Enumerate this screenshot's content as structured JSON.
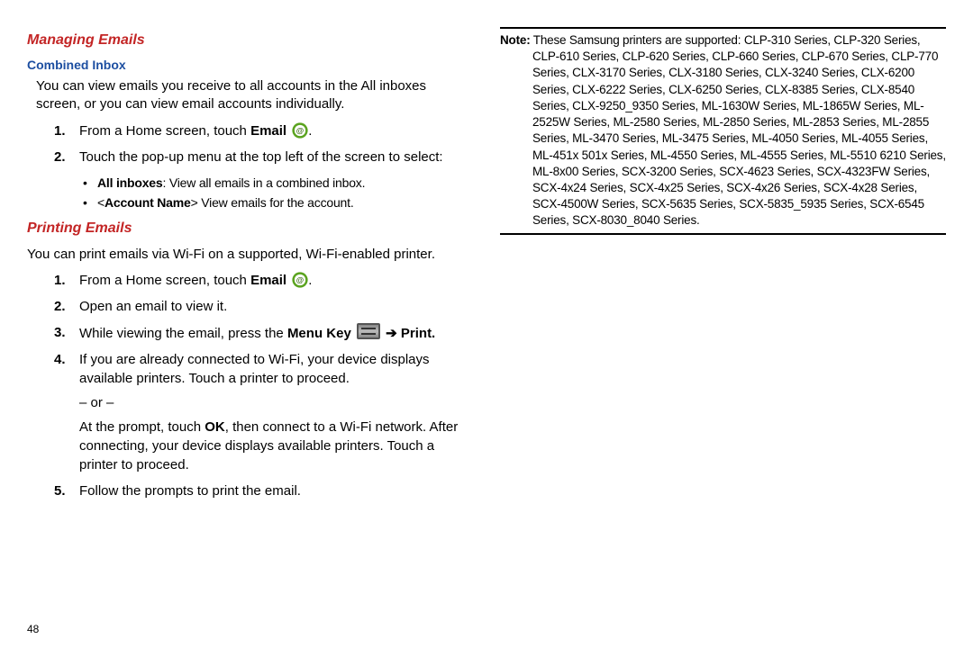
{
  "page_number": "48",
  "left": {
    "h1": "Managing Emails",
    "h2": "Combined Inbox",
    "combined_para": "You can view emails you receive to all accounts in the All inboxes screen, or you can view email accounts individually.",
    "steps_combined": {
      "s1_a": "From a Home screen, touch ",
      "s1_b": "Email",
      "s1_c": ".",
      "s2": "Touch the pop-up menu at the top left of the screen to select:"
    },
    "bullets": {
      "b1_a": "All inboxes",
      "b1_b": ": View all emails in a combined inbox.",
      "b2_a": "<",
      "b2_b": "Account Name",
      "b2_c": "> View emails for the account."
    },
    "h1b": "Printing Emails",
    "print_para": "You can print emails via Wi-Fi on a supported, Wi-Fi-enabled printer.",
    "steps_print": {
      "s1_a": "From a Home screen, touch ",
      "s1_b": "Email",
      "s1_c": ".",
      "s2": "Open an email to view it.",
      "s3_a": "While viewing the email, press the ",
      "s3_b": "Menu Key",
      "s3_c": " ",
      "s3_d": "Print.",
      "s4_a": "If you are already connected to Wi-Fi, your device displays available printers. Touch a printer to proceed.",
      "s4_or": "– or –",
      "s4_b_a": "At the prompt, touch ",
      "s4_b_b": "OK",
      "s4_b_c": ", then connect to a Wi-Fi network. After connecting, your device displays available printers. Touch a printer to proceed.",
      "s5": "Follow the prompts to print the email."
    },
    "arrow": "➔"
  },
  "right": {
    "note_label": "Note:",
    "note_text": " These Samsung printers are supported: CLP-310 Series, CLP-320 Series, CLP-610 Series, CLP-620 Series, CLP-660 Series, CLP-670 Series, CLP-770 Series, CLX-3170 Series, CLX-3180 Series, CLX-3240 Series, CLX-6200 Series, CLX-6222 Series, CLX-6250 Series, CLX-8385 Series, CLX-8540 Series, CLX-9250_9350 Series, ML-1630W Series, ML-1865W Series, ML-2525W Series, ML-2580 Series, ML-2850 Series, ML-2853 Series, ML-2855 Series, ML-3470 Series, ML-3475 Series, ML-4050 Series, ML-4055 Series, ML-451x 501x Series, ML-4550 Series, ML-4555 Series, ML-5510 6210 Series, ML-8x00 Series,  SCX-3200 Series, SCX-4623 Series, SCX-4323FW Series, SCX-4x24 Series, SCX-4x25 Series, SCX-4x26 Series, SCX-4x28 Series, SCX-4500W Series, SCX-5635 Series, SCX-5835_5935 Series, SCX-6545 Series, SCX-8030_8040 Series."
  }
}
